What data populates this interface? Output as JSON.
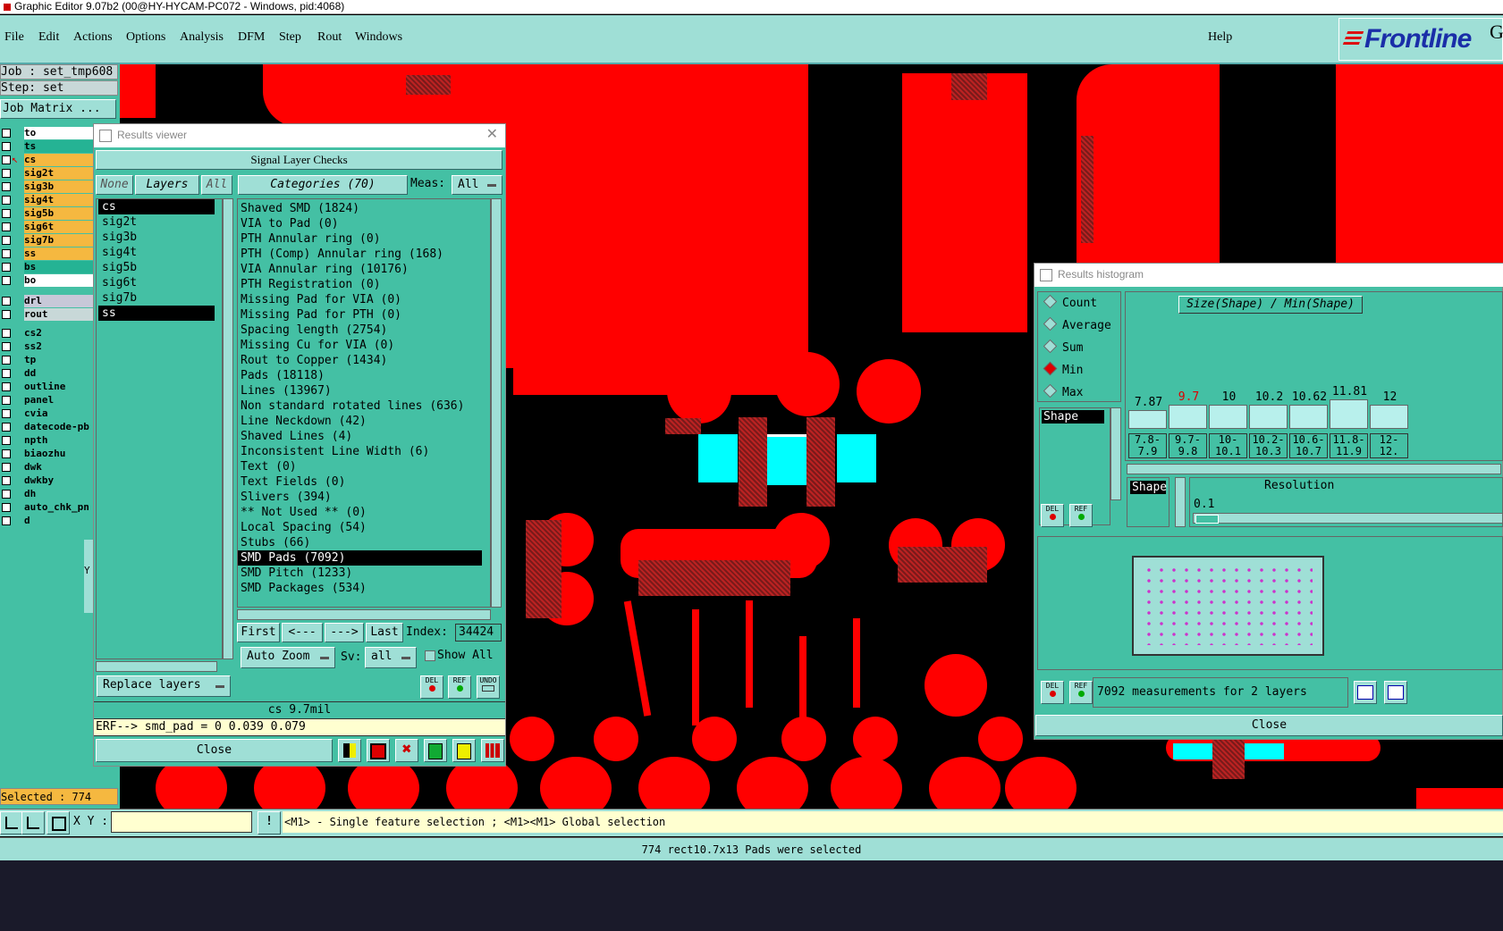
{
  "window": {
    "title": "Graphic Editor 9.07b2 (00@HY-HYCAM-PC072 - Windows, pid:4068)"
  },
  "menu": {
    "items": [
      "File",
      "Edit",
      "Actions",
      "Options",
      "Analysis",
      "DFM",
      "Step",
      "Rout",
      "Windows"
    ],
    "help": "Help",
    "brand": "Frontline",
    "brand_extra": "G"
  },
  "job": {
    "job_label": "Job : set_tmp608",
    "step_label": "Step: set",
    "matrix_button": "Job Matrix ..."
  },
  "layers": [
    {
      "name": "to",
      "color": "#ffffff"
    },
    {
      "name": "ts",
      "color": "#25b394"
    },
    {
      "name": "cs",
      "color": "#f5b840"
    },
    {
      "name": "sig2t",
      "color": "#f5b840"
    },
    {
      "name": "sig3b",
      "color": "#f5b840"
    },
    {
      "name": "sig4t",
      "color": "#f5b840"
    },
    {
      "name": "sig5b",
      "color": "#f5b840"
    },
    {
      "name": "sig6t",
      "color": "#f5b840"
    },
    {
      "name": "sig7b",
      "color": "#f5b840"
    },
    {
      "name": "ss",
      "color": "#f5b840"
    },
    {
      "name": "bs",
      "color": "#25b394"
    },
    {
      "name": "bo",
      "color": "#ffffff"
    },
    {
      "name": "drl",
      "color": "#c8c8d8"
    },
    {
      "name": "rout",
      "color": "#c8d8d8"
    },
    {
      "name": "cs2",
      "color": "#44c0a4"
    },
    {
      "name": "ss2",
      "color": "#44c0a4"
    },
    {
      "name": "tp",
      "color": "#44c0a4"
    },
    {
      "name": "dd",
      "color": "#44c0a4"
    },
    {
      "name": "outline",
      "color": "#44c0a4"
    },
    {
      "name": "panel",
      "color": "#44c0a4"
    },
    {
      "name": "cvia",
      "color": "#44c0a4"
    },
    {
      "name": "datecode-pb",
      "color": "#44c0a4"
    },
    {
      "name": "npth",
      "color": "#44c0a4"
    },
    {
      "name": "biaozhu",
      "color": "#44c0a4"
    },
    {
      "name": "dwk",
      "color": "#44c0a4"
    },
    {
      "name": "dwkby",
      "color": "#44c0a4"
    },
    {
      "name": "dh",
      "color": "#44c0a4"
    },
    {
      "name": "auto_chk_pn",
      "color": "#44c0a4"
    },
    {
      "name": "d",
      "color": "#44c0a4"
    }
  ],
  "selected_count": "Selected : 774",
  "results_viewer": {
    "title": "Results viewer",
    "header": "Signal Layer Checks",
    "none_btn": "None",
    "layers_btn": "Layers",
    "all_btn": "All",
    "categories_btn": "Categories (70)",
    "meas_label": "Meas:",
    "meas_value": "All",
    "layer_list": [
      "cs",
      "sig2t",
      "sig3b",
      "sig4t",
      "sig5b",
      "sig6t",
      "sig7b",
      "ss"
    ],
    "selected_layers": [
      "cs",
      "ss"
    ],
    "categories": [
      "Shaved SMD (1824)",
      "VIA to Pad (0)",
      "PTH Annular ring (0)",
      "PTH (Comp) Annular ring (168)",
      "VIA Annular ring (10176)",
      "PTH Registration (0)",
      "Missing Pad for VIA (0)",
      "Missing Pad for PTH (0)",
      "Spacing length (2754)",
      "Missing Cu for VIA (0)",
      "Rout to Copper (1434)",
      "Pads (18118)",
      "Lines (13967)",
      "Non standard rotated lines (636)",
      "Line Neckdown (42)",
      "Shaved Lines (4)",
      "Inconsistent Line Width (6)",
      "Text (0)",
      "Text Fields (0)",
      "Slivers (394)",
      "** Not Used ** (0)",
      "Local Spacing (54)",
      "Stubs (66)",
      "SMD Pads (7092)",
      "SMD Pitch (1233)",
      "SMD Packages (534)"
    ],
    "selected_category": "SMD Pads (7092)",
    "first_btn": "First",
    "prev_btn": "<---",
    "next_btn": "--->",
    "last_btn": "Last",
    "index_label": "Index:",
    "index_value": "34424",
    "auto_zoom": "Auto Zoom",
    "sv_label": "Sv:",
    "sv_value": "all",
    "show_all": "Show All",
    "replace_layers": "Replace layers",
    "status_line": "cs 9.7mil",
    "erf_line": "ERF--> smd_pad = 0 0.039 0.079",
    "close": "Close",
    "del": "DEL",
    "ref": "REF",
    "undo": "UNDO"
  },
  "histogram": {
    "title": "Results histogram",
    "options": [
      "Count",
      "Average",
      "Sum",
      "Min",
      "Max"
    ],
    "selected_option": "Min",
    "heading": "Size(Shape) / Min(Shape)",
    "bars": [
      {
        "top": "7.87",
        "low": "7.8-",
        "high": "7.9",
        "level": 0.35,
        "highlight": false
      },
      {
        "top": "9.7",
        "low": "9.7-",
        "high": "9.8",
        "level": 0.45,
        "highlight": true
      },
      {
        "top": "10",
        "low": "10-",
        "high": "10.1",
        "level": 0.45,
        "highlight": false
      },
      {
        "top": "10.2",
        "low": "10.2-",
        "high": "10.3",
        "level": 0.45,
        "highlight": false
      },
      {
        "top": "10.62",
        "low": "10.6-",
        "high": "10.7",
        "level": 0.45,
        "highlight": false
      },
      {
        "top": "11.81",
        "low": "11.8-",
        "high": "11.9",
        "level": 0.55,
        "highlight": false
      },
      {
        "top": "12",
        "low": "12-",
        "high": "12.",
        "level": 0.45,
        "highlight": false
      }
    ],
    "shape_list_item": "Shape",
    "shape_label": "Shape",
    "resolution_label": "Resolution",
    "resolution_value": "0.1",
    "measurements": "7092 measurements for 2 layers",
    "close": "Close",
    "del": "DEL",
    "ref": "REF"
  },
  "statusbar": {
    "xy_label": "X Y :",
    "xy_value": "",
    "hint": "<M1> - Single feature selection ; <M1><M1> Global selection",
    "message": "774 rect10.7x13 Pads were selected"
  },
  "side_letter": "Y"
}
